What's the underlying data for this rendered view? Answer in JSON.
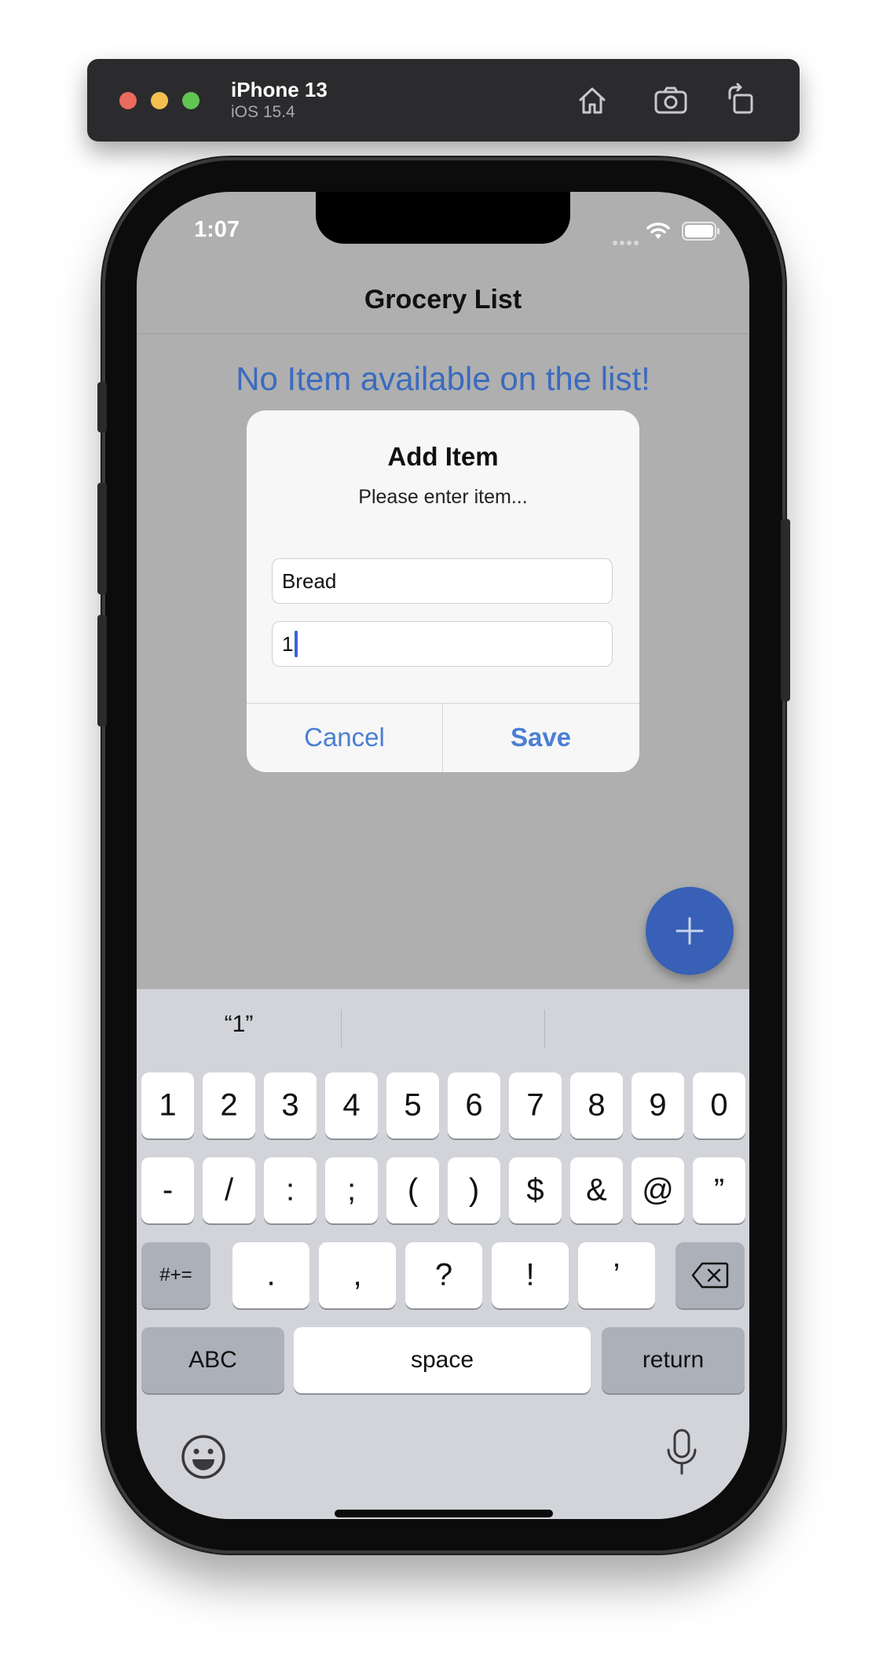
{
  "simulator": {
    "device_name": "iPhone 13",
    "os_version": "iOS 15.4",
    "icons": [
      "home-icon",
      "camera-icon",
      "rotate-icon"
    ]
  },
  "status_bar": {
    "time": "1:07",
    "icons": [
      "wifi-icon",
      "battery-icon"
    ]
  },
  "app": {
    "title": "Grocery List",
    "empty_message": "No Item available on the list!",
    "accent_color": "#3a6bbf",
    "fab_icon": "plus-icon"
  },
  "alert": {
    "title": "Add Item",
    "message": "Please enter item...",
    "item_name_value": "Bread",
    "quantity_value": "1",
    "cancel_label": "Cancel",
    "save_label": "Save"
  },
  "keyboard": {
    "suggestions": [
      "“1”",
      "",
      ""
    ],
    "row1": [
      "1",
      "2",
      "3",
      "4",
      "5",
      "6",
      "7",
      "8",
      "9",
      "0"
    ],
    "row2": [
      "-",
      "/",
      ":",
      ";",
      "(",
      ")",
      "$",
      "&",
      "@",
      "”"
    ],
    "row3": [
      ".",
      ",",
      "?",
      "!",
      "’"
    ],
    "symbols_label": "#+=",
    "abc_label": "ABC",
    "space_label": "space",
    "return_label": "return",
    "icons": [
      "delete-icon",
      "emoji-icon",
      "mic-icon"
    ]
  }
}
